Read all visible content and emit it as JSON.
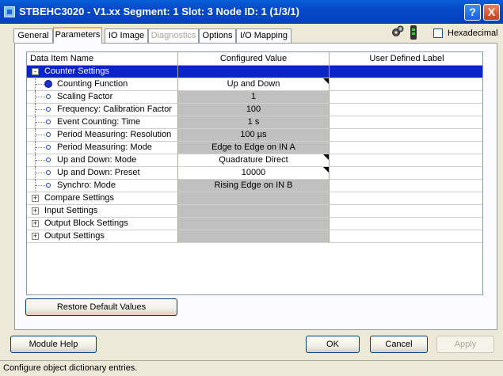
{
  "window": {
    "title": "STBEHC3020 - V1.xx Segment: 1 Slot: 3 Node ID: 1 (1/3/1)",
    "help_glyph": "?",
    "close_glyph": "X"
  },
  "tabs": [
    {
      "label": "General",
      "state": "normal"
    },
    {
      "label": "Parameters",
      "state": "active"
    },
    {
      "label": "IO Image",
      "state": "normal"
    },
    {
      "label": "Diagnostics",
      "state": "disabled"
    },
    {
      "label": "Options",
      "state": "normal"
    },
    {
      "label": "I/O Mapping",
      "state": "normal"
    }
  ],
  "toolbar": {
    "icons": [
      "gears-icon",
      "device-icon"
    ],
    "hexadecimal_label": "Hexadecimal",
    "hexadecimal_checked": false
  },
  "grid": {
    "columns": [
      "Data Item Name",
      "Configured Value",
      "User Defined Label"
    ],
    "rows": [
      {
        "name": "Counter Settings",
        "value": "",
        "level": 0,
        "expander": "-",
        "selected": true,
        "value_style": "none"
      },
      {
        "name": "Counting Function",
        "value": "Up and Down",
        "level": 1,
        "bullet": "filled",
        "value_style": "white",
        "dropdown": true
      },
      {
        "name": "Scaling Factor",
        "value": "1",
        "level": 1,
        "bullet": "open",
        "value_style": "gray"
      },
      {
        "name": "Frequency: Calibration Factor",
        "value": "100",
        "level": 1,
        "bullet": "open",
        "value_style": "gray"
      },
      {
        "name": "Event Counting: Time",
        "value": "1 s",
        "level": 1,
        "bullet": "open",
        "value_style": "gray"
      },
      {
        "name": "Period Measuring: Resolution",
        "value": "100 µs",
        "level": 1,
        "bullet": "open",
        "value_style": "gray"
      },
      {
        "name": "Period Measuring: Mode",
        "value": "Edge to Edge on IN A",
        "level": 1,
        "bullet": "open",
        "value_style": "gray"
      },
      {
        "name": "Up and Down: Mode",
        "value": "Quadrature Direct",
        "level": 1,
        "bullet": "open",
        "value_style": "white",
        "dropdown": true
      },
      {
        "name": "Up and Down: Preset",
        "value": "10000",
        "level": 1,
        "bullet": "open",
        "value_style": "white",
        "dropdown": true
      },
      {
        "name": "Synchro: Mode",
        "value": "Rising Edge on IN B",
        "level": 1,
        "bullet": "open",
        "value_style": "gray"
      },
      {
        "name": "Compare Settings",
        "value": "",
        "level": 0,
        "expander": "+",
        "value_style": "gray"
      },
      {
        "name": "Input Settings",
        "value": "",
        "level": 0,
        "expander": "+",
        "value_style": "gray"
      },
      {
        "name": "Output Block Settings",
        "value": "",
        "level": 0,
        "expander": "+",
        "value_style": "gray"
      },
      {
        "name": "Output Settings",
        "value": "",
        "level": 0,
        "expander": "+",
        "value_style": "gray"
      }
    ]
  },
  "buttons": {
    "restore_defaults": "Restore Default Values",
    "module_help": "Module Help",
    "ok": "OK",
    "cancel": "Cancel",
    "apply": "Apply"
  },
  "status_bar": {
    "text": "Configure object dictionary entries."
  },
  "colors": {
    "selection": "#0a24c8",
    "title_bar": "#0348c9",
    "readonly_cell": "#c0c0c0"
  }
}
